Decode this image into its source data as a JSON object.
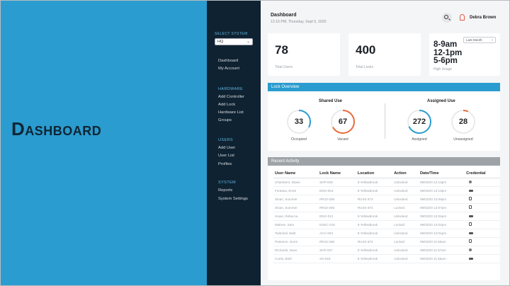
{
  "hero": {
    "title": "Dashboard"
  },
  "sidebar": {
    "select_label": "SELECT SYSTEM",
    "select_value": "HQ",
    "links_top": [
      "Dashboard",
      "My Account"
    ],
    "hardware_head": "HARDWARE",
    "hardware_links": [
      "Add Controller",
      "Add Lock",
      "Hardware List",
      "Groups"
    ],
    "users_head": "USERS",
    "users_links": [
      "Add User",
      "User List",
      "Profiles"
    ],
    "system_head": "SYSTEM",
    "system_links": [
      "Reports",
      "System Settings"
    ]
  },
  "header": {
    "title": "Dashboard",
    "date": "12:16 PM, Thursday, Sept 5, 2020",
    "user_name": "Debra Brown",
    "icons": [
      "search-icon",
      "bell-icon"
    ]
  },
  "stats": {
    "total_users_value": "78",
    "total_users_label": "Total Users",
    "total_locks_value": "400",
    "total_locks_label": "Total Locks",
    "high_usage_lines": [
      "8-9am",
      "12-1pm",
      "5-6pm"
    ],
    "high_usage_label": "High Usage",
    "range_select": "Last Month"
  },
  "overview": {
    "title": "Lock Overview",
    "shared_head": "Shared Use",
    "assigned_head": "Assigned Use",
    "gauges": [
      {
        "value": "33",
        "label": "Occupied",
        "fraction": 0.33,
        "color": "#2a9ccf"
      },
      {
        "value": "67",
        "label": "Vacant",
        "fraction": 0.67,
        "color": "#e86b3a"
      },
      {
        "value": "272",
        "label": "Assigned",
        "fraction": 0.68,
        "color": "#2a9ccf"
      },
      {
        "value": "28",
        "label": "Unassigned",
        "fraction": 0.07,
        "color": "#e86b3a"
      }
    ]
  },
  "activity": {
    "title": "Recent Activity",
    "columns": [
      "User Name",
      "Lock Name",
      "Location",
      "Action",
      "Date/Time",
      "Credential"
    ],
    "rows": [
      [
        "Chambers, Diane",
        "SHP-029",
        "9 Yellowbrook",
        "Unlocked",
        "09/03/20 12:13pm",
        "fob"
      ],
      [
        "Fontana, Ernie",
        "ENG-004",
        "9 Yellowbrook",
        "Unlocked",
        "09/03/20 12:13pm",
        "card"
      ],
      [
        "Sloan, Summer",
        "RR10-306",
        "RUSS 872",
        "Unlocked",
        "09/03/20 12:09pm",
        "phone"
      ],
      [
        "Sloan, Summer",
        "RR10-305",
        "RUSS 872",
        "Locked",
        "09/03/20 12:07pm",
        "phone"
      ],
      [
        "Howe, Rebecca",
        "ENG-012",
        "9 Yellowbrook",
        "Unlocked",
        "09/03/20 12:04pm",
        "card"
      ],
      [
        "Malone, Sam",
        "EXEC-015",
        "9 Yellowbrook",
        "Locked",
        "09/03/20 12:04pm",
        "phone"
      ],
      [
        "Twitchell, Walt",
        "ACC-004",
        "9 Yellowbrook",
        "Unlocked",
        "09/03/20 12:01pm",
        "card"
      ],
      [
        "Peterson, Norm",
        "RR10-306",
        "RUSS 872",
        "Locked",
        "09/03/20 11:59am",
        "phone"
      ],
      [
        "Richards, Dave",
        "SHP-027",
        "9 Yellowbrook",
        "Unlocked",
        "09/03/20 11:57am",
        "fob"
      ],
      [
        "Curtis, Beth",
        "SS-018",
        "9 Yellowbrook",
        "Unlocked",
        "09/03/20 11:55am",
        "card"
      ]
    ]
  }
}
